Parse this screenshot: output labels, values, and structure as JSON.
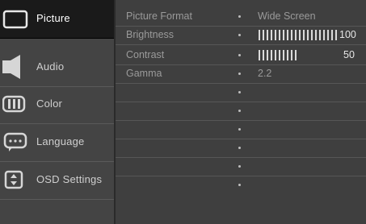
{
  "sidebar": {
    "items": [
      {
        "label": "Picture",
        "icon": "picture-icon"
      },
      {
        "label": "Audio",
        "icon": "speaker-icon"
      },
      {
        "label": "Color",
        "icon": "color-icon"
      },
      {
        "label": "Language",
        "icon": "language-icon"
      },
      {
        "label": "OSD Settings",
        "icon": "osd-settings-icon"
      }
    ],
    "active": "Picture"
  },
  "settings": [
    {
      "name": "Picture Format",
      "value": "Wide Screen"
    },
    {
      "name": "Brightness",
      "value": "100",
      "level": 1.0
    },
    {
      "name": "Contrast",
      "value": "50",
      "level": 0.5
    },
    {
      "name": "Gamma",
      "value": "2.2"
    },
    {
      "name": "",
      "value": ""
    },
    {
      "name": "",
      "value": ""
    },
    {
      "name": "",
      "value": ""
    },
    {
      "name": "",
      "value": ""
    },
    {
      "name": "",
      "value": ""
    }
  ],
  "colors": {
    "active_bg": "#1a1a1a",
    "panel_bg": "#3f3f3f",
    "bar": "#dadada"
  }
}
